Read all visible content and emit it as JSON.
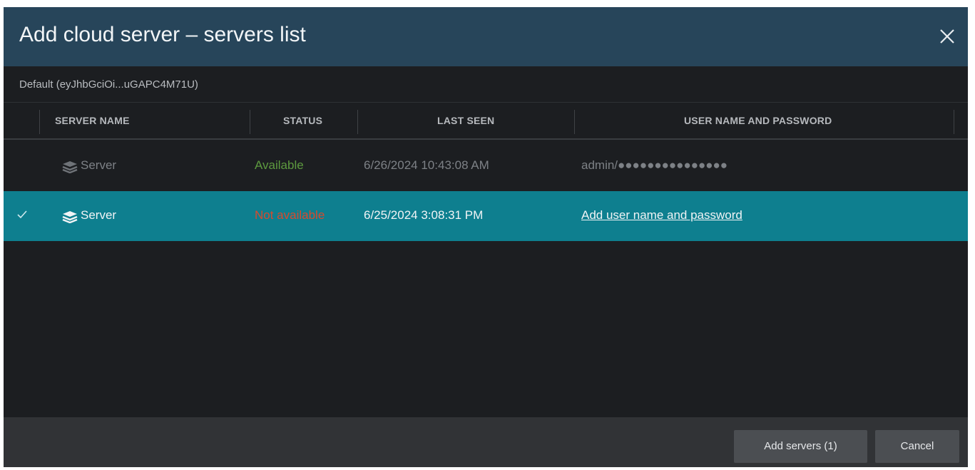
{
  "dialog": {
    "title": "Add cloud server – servers list",
    "token_label": "Default (eyJhbGciOi...uGAPC4M71U)"
  },
  "table": {
    "columns": [
      "SERVER NAME",
      "STATUS",
      "LAST SEEN",
      "USER NAME AND PASSWORD"
    ],
    "rows": [
      {
        "selected": false,
        "icon": "server-stack-icon",
        "name": "Server",
        "status": "Available",
        "last_seen": "6/26/2024 10:43:08 AM",
        "credentials": "admin/●●●●●●●●●●●●●●●"
      },
      {
        "selected": true,
        "icon": "server-stack-icon",
        "name": "Server",
        "status": "Not available",
        "last_seen": "6/25/2024 3:08:31 PM",
        "credentials": "Add user name and password"
      }
    ]
  },
  "footer": {
    "add_label": "Add servers (1)",
    "cancel_label": "Cancel"
  },
  "colors": {
    "titlebar": "#27455a",
    "selected_row": "#0e7f8f",
    "status_available": "#5d9a3f",
    "status_not_available": "#d74a2e"
  },
  "icons": [
    "close-icon",
    "checkmark-icon",
    "server-stack-icon"
  ]
}
